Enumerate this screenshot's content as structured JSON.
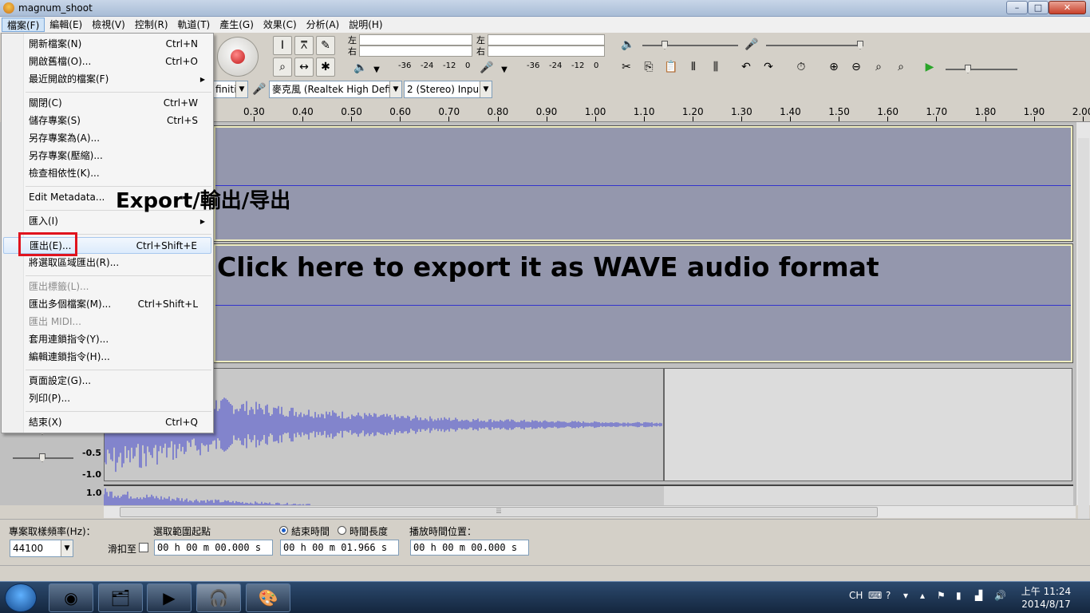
{
  "window": {
    "title": "magnum_shoot",
    "minimize": "–",
    "maximize": "□",
    "close": "✕"
  },
  "menubar": {
    "items": [
      "檔案(F)",
      "編輯(E)",
      "檢視(V)",
      "控制(R)",
      "軌道(T)",
      "產生(G)",
      "效果(C)",
      "分析(A)",
      "說明(H)"
    ]
  },
  "file_menu": {
    "items": [
      {
        "label": "開新檔案(N)",
        "shortcut": "Ctrl+N"
      },
      {
        "label": "開啟舊檔(O)...",
        "shortcut": "Ctrl+O"
      },
      {
        "label": "最近開啟的檔案(F)",
        "shortcut": "",
        "submenu": "▶"
      },
      {
        "label": "關閉(C)",
        "shortcut": "Ctrl+W"
      },
      {
        "label": "儲存專案(S)",
        "shortcut": "Ctrl+S"
      },
      {
        "label": "另存專案為(A)...",
        "shortcut": ""
      },
      {
        "label": "另存專案(壓縮)...",
        "shortcut": ""
      },
      {
        "label": "檢查相依性(K)...",
        "shortcut": ""
      },
      {
        "label": "Edit Metadata...",
        "shortcut": ""
      },
      {
        "label": "匯入(I)",
        "shortcut": "",
        "submenu": "▶"
      },
      {
        "label": "匯出(E)...",
        "shortcut": "Ctrl+Shift+E"
      },
      {
        "label": "將選取區域匯出(R)...",
        "shortcut": ""
      },
      {
        "label": "匯出標籤(L)...",
        "shortcut": ""
      },
      {
        "label": "匯出多個檔案(M)...",
        "shortcut": "Ctrl+Shift+L"
      },
      {
        "label": "匯出 MIDI...",
        "shortcut": ""
      },
      {
        "label": "套用連鎖指令(Y)...",
        "shortcut": ""
      },
      {
        "label": "編輯連鎖指令(H)...",
        "shortcut": ""
      },
      {
        "label": "頁面設定(G)...",
        "shortcut": ""
      },
      {
        "label": "列印(P)...",
        "shortcut": ""
      },
      {
        "label": "結束(X)",
        "shortcut": "Ctrl+Q"
      }
    ]
  },
  "annotations": {
    "export": "Export/輸出/导出",
    "click": "Click here to export it as WAVE audio format"
  },
  "meters": {
    "left": "左",
    "right": "右",
    "scale": [
      "-36",
      "-24",
      "-12",
      "0"
    ]
  },
  "device_toolbar": {
    "host_partial": "finitic",
    "input_device": "麥克風 (Realtek High Defin",
    "channels": "2 (Stereo) Inpu"
  },
  "ruler": {
    "ticks": [
      "0.30",
      "0.40",
      "0.50",
      "0.60",
      "0.70",
      "0.80",
      "0.90",
      "1.00",
      "1.10",
      "1.20",
      "1.30",
      "1.40",
      "1.50",
      "1.60",
      "1.70",
      "1.80",
      "1.90",
      "2.00"
    ]
  },
  "wave_scale": [
    "-0.5",
    "-1.0",
    "1.0"
  ],
  "selection_bar": {
    "rate_label": "專案取樣頻率(Hz)：",
    "rate_value": "44100",
    "snap_label": "滑扣至",
    "start_label": "選取範圍起點",
    "end_label": "結束時間",
    "length_label": "時間長度",
    "position_label": "播放時間位置：",
    "start_time": "00 h 00 m 00.000 s",
    "end_time": "00 h 00 m 01.966 s",
    "position_time": "00 h 00 m 00.000 s"
  },
  "taskbar": {
    "lang": "CH",
    "time": "上午 11:24",
    "date": "2014/8/17"
  }
}
